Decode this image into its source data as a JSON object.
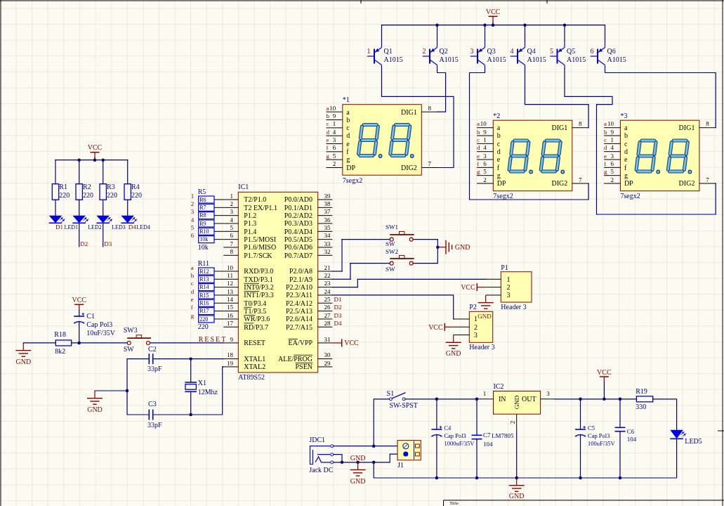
{
  "transistor_array": {
    "supply": "VCC",
    "transistors": [
      {
        "base_net": "1",
        "designator": "Q1",
        "part": "A1015"
      },
      {
        "base_net": "2",
        "designator": "Q2",
        "part": "A1015"
      },
      {
        "base_net": "3",
        "designator": "Q3",
        "part": "A1015"
      },
      {
        "base_net": "4",
        "designator": "Q4",
        "part": "A1015"
      },
      {
        "base_net": "5",
        "designator": "Q5",
        "part": "A1015"
      },
      {
        "base_net": "6",
        "designator": "Q6",
        "part": "A1015"
      }
    ]
  },
  "displays": [
    {
      "designator": "*1",
      "part": "7segx2",
      "segment_pins": [
        {
          "net": "a",
          "number": "10",
          "name": "a"
        },
        {
          "net": "b",
          "number": "9",
          "name": "b"
        },
        {
          "net": "c",
          "number": "1",
          "name": "c"
        },
        {
          "net": "d",
          "number": "4",
          "name": "d"
        },
        {
          "net": "e",
          "number": "3",
          "name": "e"
        },
        {
          "net": "f",
          "number": "6",
          "name": "f"
        },
        {
          "net": "g",
          "number": "5",
          "name": "g"
        },
        {
          "number": "2",
          "name": "DP"
        }
      ],
      "digit_pins": [
        {
          "number": "8",
          "name": "DIG1"
        },
        {
          "number": "7",
          "name": "DIG2"
        }
      ]
    },
    {
      "designator": "*2",
      "part": "7segx2",
      "segment_pins": [
        {
          "net": "a",
          "number": "10",
          "name": "a"
        },
        {
          "net": "b",
          "number": "9",
          "name": "b"
        },
        {
          "net": "c",
          "number": "1",
          "name": "c"
        },
        {
          "net": "d",
          "number": "4",
          "name": "d"
        },
        {
          "net": "e",
          "number": "3",
          "name": "e"
        },
        {
          "net": "f",
          "number": "6",
          "name": "f"
        },
        {
          "net": "g",
          "number": "5",
          "name": "g"
        },
        {
          "number": "2",
          "name": "DP"
        }
      ],
      "digit_pins": [
        {
          "number": "8",
          "name": "DIG1"
        },
        {
          "number": "7",
          "name": "DIG2"
        }
      ]
    },
    {
      "designator": "*3",
      "part": "7segx2",
      "segment_pins": [
        {
          "net": "a",
          "number": "10",
          "name": "a"
        },
        {
          "net": "b",
          "number": "9",
          "name": "b"
        },
        {
          "net": "c",
          "number": "1",
          "name": "c"
        },
        {
          "net": "d",
          "number": "4",
          "name": "d"
        },
        {
          "net": "e",
          "number": "3",
          "name": "e"
        },
        {
          "net": "f",
          "number": "6",
          "name": "f"
        },
        {
          "net": "g",
          "number": "5",
          "name": "g"
        },
        {
          "number": "2",
          "name": "DP"
        }
      ],
      "digit_pins": [
        {
          "number": "8",
          "name": "DIG1"
        },
        {
          "number": "7",
          "name": "DIG2"
        }
      ]
    }
  ],
  "led_array": {
    "supply": "VCC",
    "resistors": [
      {
        "designator": "R1",
        "value": "220"
      },
      {
        "designator": "R2",
        "value": "220"
      },
      {
        "designator": "R3",
        "value": "220"
      },
      {
        "designator": "R4",
        "value": "220"
      }
    ],
    "leds": [
      {
        "designator": "LED1",
        "net": "D1"
      },
      {
        "designator": "LED2",
        "net": "D2"
      },
      {
        "designator": "LED3",
        "net": "D3"
      },
      {
        "designator": "LED4",
        "net": "D4"
      }
    ]
  },
  "resistor_networks": [
    {
      "designator": "R5",
      "value": "10k",
      "nets": [
        "1",
        "2",
        "3",
        "4",
        "5",
        "6"
      ],
      "element_labels": [
        "R6",
        "R7",
        "R8",
        "R9",
        "R10",
        "10k"
      ]
    },
    {
      "designator": "R11",
      "value": "220",
      "nets": [
        "a",
        "b",
        "c",
        "d",
        "e",
        "f",
        "g"
      ],
      "element_labels": [
        "R12",
        "R13",
        "R14",
        "R15",
        "R16",
        "R17",
        "220"
      ]
    }
  ],
  "microcontroller": {
    "designator": "IC1",
    "part": "AT89S52",
    "left_pins": [
      {
        "number": "1",
        "name": "T2/P1.0"
      },
      {
        "number": "2",
        "name": "T2 EX/P1.1"
      },
      {
        "number": "3",
        "name": "P1.2"
      },
      {
        "number": "4",
        "name": "P1.3"
      },
      {
        "number": "5",
        "name": "P1.4"
      },
      {
        "number": "6",
        "name": "P1.5/MOSI"
      },
      {
        "number": "7",
        "name": "P1.6/MISO"
      },
      {
        "number": "8",
        "name": "P1.7/SCK"
      },
      {
        "number": "10",
        "name": "RXD/P3.0"
      },
      {
        "number": "11",
        "name": "TXD/P3.1"
      },
      {
        "number": "12",
        "name": [
          {
            "text": "INT0",
            "overline": true
          },
          {
            "text": "/P3.2",
            "overline": false
          }
        ]
      },
      {
        "number": "13",
        "name": [
          {
            "text": "INT1",
            "overline": true
          },
          {
            "text": "/P3.3",
            "overline": false
          }
        ]
      },
      {
        "number": "14",
        "name": "T0/P3.4"
      },
      {
        "number": "15",
        "name": [
          {
            "text": "T1",
            "overline": true
          },
          {
            "text": "/P3.5",
            "overline": false
          }
        ]
      },
      {
        "number": "16",
        "name": [
          {
            "text": "WR",
            "overline": true
          },
          {
            "text": "/P3.6",
            "overline": false
          }
        ]
      },
      {
        "number": "17",
        "name": [
          {
            "text": "RD",
            "overline": true
          },
          {
            "text": "/P3.7",
            "overline": false
          }
        ]
      },
      {
        "number": "9",
        "name": "RESET"
      },
      {
        "number": "18",
        "name": "XTAL1"
      },
      {
        "number": "19",
        "name": "XTAL2"
      }
    ],
    "right_pins": [
      {
        "number": "39",
        "name": "P0.0/AD0"
      },
      {
        "number": "38",
        "name": "P0.1/AD1"
      },
      {
        "number": "37",
        "name": "P0.2/AD2"
      },
      {
        "number": "36",
        "name": "P0.3/AD3"
      },
      {
        "number": "35",
        "name": "P0.4/AD4"
      },
      {
        "number": "34",
        "name": "P0.5/AD5"
      },
      {
        "number": "33",
        "name": "P0.6/AD6"
      },
      {
        "number": "32",
        "name": "P0.7/AD7"
      },
      {
        "number": "21",
        "name": "P2.0/A8"
      },
      {
        "number": "22",
        "name": "P2.1/A9"
      },
      {
        "number": "23",
        "name": "P2.2/A10"
      },
      {
        "number": "24",
        "name": "P2.3/A11"
      },
      {
        "number": "25",
        "name": "P2.4/A12"
      },
      {
        "number": "26",
        "name": "P2.5/A13"
      },
      {
        "number": "27",
        "name": "P2.6/A14"
      },
      {
        "number": "28",
        "name": "P2.7/A15"
      },
      {
        "number": "31",
        "name": [
          {
            "text": "EA",
            "overline": true
          },
          {
            "text": "/VPP",
            "overline": false
          }
        ]
      },
      {
        "number": "30",
        "name": [
          {
            "text": "ALE/",
            "overline": false
          },
          {
            "text": "PROG",
            "overline": true
          }
        ]
      },
      {
        "number": "29",
        "name": [
          {
            "text": "PSEN",
            "overline": true
          }
        ]
      }
    ],
    "reset_net": "RESET",
    "port2_nets": [
      "D1",
      "D2",
      "D3",
      "D4"
    ],
    "ea_supply": "VCC"
  },
  "reset_circuit": {
    "capacitor": {
      "designator": "C1",
      "type": "Cap Pol3",
      "value": "10uF/35V",
      "supply": "VCC"
    },
    "resistor": {
      "designator": "R18",
      "value": "8k2",
      "ground": "GND"
    },
    "switch": {
      "designator": "SW3",
      "type": "SW"
    }
  },
  "oscillator": {
    "capacitors": [
      {
        "designator": "C2",
        "value": "33pF"
      },
      {
        "designator": "C3",
        "value": "33pF"
      }
    ],
    "crystal": {
      "designator": "X1",
      "value": "12Mhz"
    },
    "ground": "GND"
  },
  "push_buttons": {
    "switches": [
      {
        "designator": "SW1",
        "type": "SW"
      },
      {
        "designator": "SW2",
        "type": "SW"
      }
    ],
    "ground": "GND"
  },
  "headers": [
    {
      "designator": "P1",
      "part": "Header 3",
      "pins": [
        "1",
        "2",
        "3"
      ],
      "supply": "VCC",
      "ground": "GND"
    },
    {
      "designator": "P2",
      "part": "Header 3",
      "pins": [
        "1",
        "2",
        "3"
      ],
      "supply": "VCC",
      "ground": "GND"
    }
  ],
  "power_supply": {
    "jack": {
      "designator": "JDC1",
      "part": "Jack DC"
    },
    "ground_net": "GND",
    "ground": "GND",
    "terminal": {
      "designator": "J1"
    },
    "switch": {
      "designator": "S1",
      "part": "SW-SPST"
    },
    "input_capacitors": [
      {
        "kind": "polarized",
        "designator": "C4",
        "type": "Cap Pol3",
        "value": "1000uF/35V"
      },
      {
        "kind": "plain",
        "designator": "C7",
        "value": "104"
      }
    ],
    "regulator": {
      "designator": "IC2",
      "part": "LM7805",
      "pins": [
        {
          "number": "1",
          "name": "IN"
        },
        {
          "number": "2",
          "name": "GND"
        },
        {
          "number": "3",
          "name": "OUT"
        }
      ]
    },
    "regulator_ground": "GND",
    "output_capacitors": [
      {
        "kind": "polarized",
        "designator": "C5",
        "type": "Cap Pol3",
        "value": "100uF/35V"
      },
      {
        "kind": "plain",
        "designator": "C6",
        "value": "104"
      }
    ],
    "supply": "VCC",
    "indicator": {
      "resistor": {
        "designator": "R19",
        "value": "330"
      },
      "led": {
        "designator": "LED5"
      }
    }
  },
  "title_block": {
    "label": "Title"
  }
}
